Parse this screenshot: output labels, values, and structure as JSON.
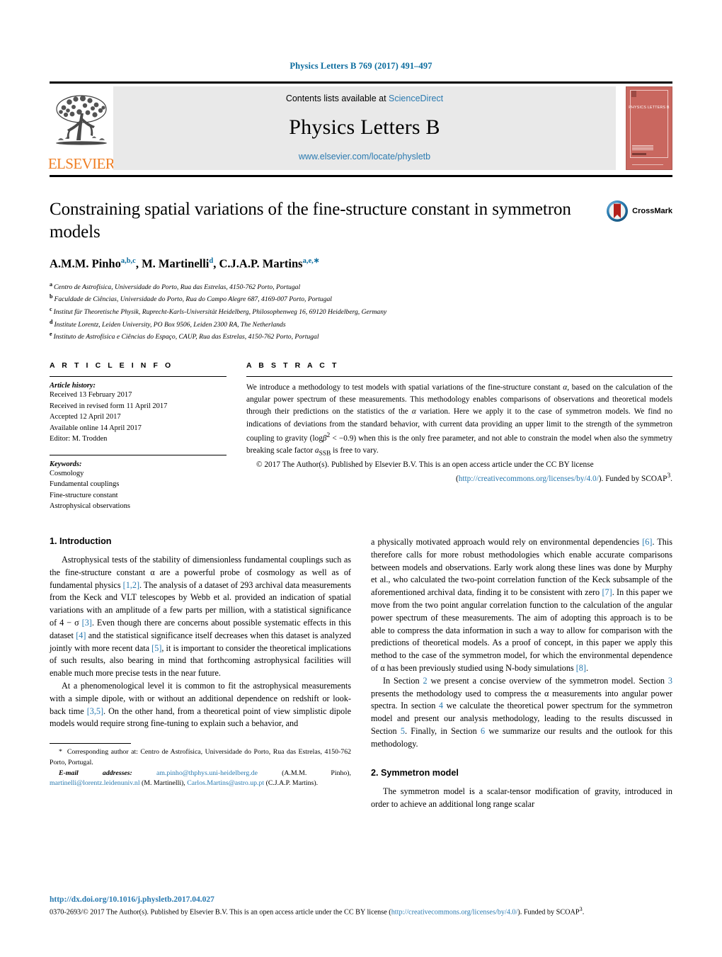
{
  "running_head": "Physics Letters B 769 (2017) 491–497",
  "masthead": {
    "contents_prefix": "Contents lists available at",
    "sciencedirect": "ScienceDirect",
    "journal_name": "Physics Letters B",
    "journal_url": "www.elsevier.com/locate/physletb",
    "publisher_logo_text": "ELSEVIER",
    "cover_title": "PHYSICS LETTERS B",
    "accent_orange": "#ef7d22",
    "accent_link": "#2a7ab0",
    "cover_red": "#c9675f"
  },
  "article": {
    "title": "Constraining spatial variations of the fine-structure constant in symmetron models",
    "authors": [
      {
        "name": "A.M.M. Pinho",
        "marks": "a,b,c"
      },
      {
        "name": "M. Martinelli",
        "marks": "d"
      },
      {
        "name": "C.J.A.P. Martins",
        "marks": "a,e,∗"
      }
    ],
    "affiliations": [
      {
        "label": "a",
        "text": "Centro de Astrofísica, Universidade do Porto, Rua das Estrelas, 4150-762 Porto, Portugal"
      },
      {
        "label": "b",
        "text": "Faculdade de Ciências, Universidade do Porto, Rua do Campo Alegre 687, 4169-007 Porto, Portugal"
      },
      {
        "label": "c",
        "text": "Institut für Theoretische Physik, Ruprecht-Karls-Universität Heidelberg, Philosophenweg 16, 69120 Heidelberg, Germany"
      },
      {
        "label": "d",
        "text": "Institute Lorentz, Leiden University, PO Box 9506, Leiden 2300 RA, The Netherlands"
      },
      {
        "label": "e",
        "text": "Instituto de Astrofísica e Ciências do Espaço, CAUP, Rua das Estrelas, 4150-762 Porto, Portugal"
      }
    ],
    "crossmark_label": "CrossMark"
  },
  "article_info": {
    "heading": "A R T I C L E    I N F O",
    "history_title": "Article history:",
    "history": [
      "Received 13 February 2017",
      "Received in revised form 11 April 2017",
      "Accepted 12 April 2017",
      "Available online 14 April 2017",
      "Editor: M. Trodden"
    ],
    "keywords_title": "Keywords:",
    "keywords": [
      "Cosmology",
      "Fundamental couplings",
      "Fine-structure constant",
      "Astrophysical observations"
    ]
  },
  "abstract": {
    "heading": "A B S T R A C T",
    "paragraph1_a": "We introduce a methodology to test models with spatial variations of the fine-structure constant ",
    "paragraph1_b": ", based on the calculation of the angular power spectrum of these measurements. This methodology enables comparisons of observations and theoretical models through their predictions on the statistics of the ",
    "paragraph1_c": " variation. Here we apply it to the case of symmetron models. We find no indications of deviations from the standard behavior, with current data providing an upper limit to the strength of the symmetron coupling to gravity (log",
    "paragraph1_d": " < −0.9) when this is the only free parameter, and not able to constrain the model when also the symmetry breaking scale factor ",
    "paragraph1_e": " is free to vary.",
    "alpha_symbol": "α",
    "beta_symbol": "β",
    "beta_exponent": "2",
    "assb_symbol": "a",
    "assb_sub": "SSB",
    "copyright_a": "© 2017 The Author(s). Published by Elsevier B.V. This is an open access article under the CC BY license",
    "copyright_b": "(",
    "license_url": "http://creativecommons.org/licenses/by/4.0/",
    "copyright_c": "). Funded by SCOAP",
    "scoap_sup": "3",
    "copyright_d": "."
  },
  "sections": {
    "intro_heading": "1. Introduction",
    "intro_p1": [
      "Astrophysical tests of the stability of dimensionless fundamental couplings such as the fine-structure constant α are a powerful probe of cosmology as well as of fundamental physics ",
      "[1,2]",
      ". The analysis of a dataset of 293 archival data measurements from the Keck and VLT telescopes by Webb et al. provided an indication of spatial variations with an amplitude of a few parts per million, with a statistical significance of 4 − σ ",
      "[3]",
      ". Even though there are concerns about possible systematic effects in this dataset ",
      "[4]",
      " and the statistical significance itself decreases when this dataset is analyzed jointly with more recent data ",
      "[5]",
      ", it is important to consider the theoretical implications of such results, also bearing in mind that forthcoming astrophysical facilities will enable much more precise tests in the near future."
    ],
    "intro_p2": [
      "At a phenomenological level it is common to fit the astrophysical measurements with a simple dipole, with or without an additional dependence on redshift or look-back time ",
      "[3,5]",
      ". On the other hand, from a theoretical point of view simplistic dipole models would require strong fine-tuning to explain such a behavior, and"
    ],
    "intro_p3": [
      "a physically motivated approach would rely on environmental dependencies ",
      "[6]",
      ". This therefore calls for more robust methodologies which enable accurate comparisons between models and observations. Early work along these lines was done by Murphy et al., who calculated the two-point correlation function of the Keck subsample of the aforementioned archival data, finding it to be consistent with zero ",
      "[7]",
      ". In this paper we move from the two point angular correlation function to the calculation of the angular power spectrum of these measurements. The aim of adopting this approach is to be able to compress the data information in such a way to allow for comparison with the predictions of theoretical models. As a proof of concept, in this paper we apply this method to the case of the symmetron model, for which the environmental dependence of α has been previously studied using N-body simulations ",
      "[8]",
      "."
    ],
    "intro_p4": [
      "In Section ",
      "2",
      " we present a concise overview of the symmetron model. Section ",
      "3",
      " presents the methodology used to compress the α measurements into angular power spectra. In section ",
      "4",
      " we calculate the theoretical power spectrum for the symmetron model and present our analysis methodology, leading to the results discussed in Section ",
      "5",
      ". Finally, in Section ",
      "6",
      " we summarize our results and the outlook for this methodology."
    ],
    "symmetron_heading": "2. Symmetron model",
    "symmetron_p1": "The symmetron model is a scalar-tensor modification of gravity, introduced in order to achieve an additional long range scalar"
  },
  "footnotes": {
    "corresponding_mark": "*",
    "corresponding_text": "Corresponding author at: Centro de Astrofísica, Universidade do Porto, Rua das Estrelas, 4150-762 Porto, Portugal.",
    "email_label": "E-mail addresses:",
    "emails": [
      {
        "address": "am.pinho@thphys.uni-heidelberg.de",
        "who": "(A.M.M. Pinho),"
      },
      {
        "address": "martinelli@lorentz.leidenuniv.nl",
        "who": "(M. Martinelli),"
      },
      {
        "address": "Carlos.Martins@astro.up.pt",
        "who": "(C.J.A.P. Martins)."
      }
    ]
  },
  "page_footer": {
    "doi": "http://dx.doi.org/10.1016/j.physletb.2017.04.027",
    "issn_copyright_a": "0370-2693/© 2017 The Author(s). Published by Elsevier B.V. This is an open access article under the CC BY license (",
    "license_url": "http://creativecommons.org/licenses/by/4.0/",
    "issn_copyright_b": "). Funded by ",
    "scoap": "SCOAP",
    "scoap_sup": "3",
    "issn_copyright_c": "."
  }
}
